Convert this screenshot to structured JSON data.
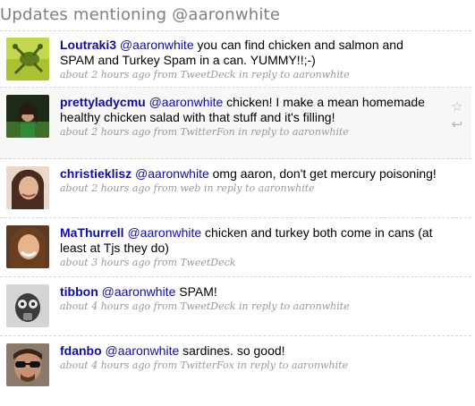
{
  "heading": "Updates mentioning @aaronwhite",
  "statuses": [
    {
      "author": "Loutraki3",
      "mention": "@aaronwhite",
      "text": " you can find chicken and salmon and SPAM and Turkey Spam in a can. YUMMY!!;-)",
      "meta": "about 2 hours ago from TweetDeck in reply to aaronwhite"
    },
    {
      "author": "prettyladycmu",
      "mention": "@aaronwhite",
      "text": " chicken! I make a mean homemade healthy chicken salad with that stuff and it's filling!",
      "meta": "about 2 hours ago from TwitterFon in reply to aaronwhite",
      "icons": {
        "favorite": "☆",
        "reply": "↩"
      }
    },
    {
      "author": "christieklisz",
      "mention": "@aaronwhite",
      "text": " omg aaron, don't get mercury poisoning!",
      "meta": "about 2 hours ago from web in reply to aaronwhite"
    },
    {
      "author": "MaThurrell",
      "mention": "@aaronwhite",
      "text": " chicken and turkey both come in cans (at least at Tjs they do)",
      "meta": "about 3 hours ago from TweetDeck"
    },
    {
      "author": "tibbon",
      "mention": "@aaronwhite",
      "text": " SPAM!",
      "meta": "about 4 hours ago from TweetDeck in reply to aaronwhite"
    },
    {
      "author": "fdanbo",
      "mention": "@aaronwhite",
      "text": " sardines. so good!",
      "meta": "about 4 hours ago from TwitterFox in reply to aaronwhite"
    }
  ]
}
